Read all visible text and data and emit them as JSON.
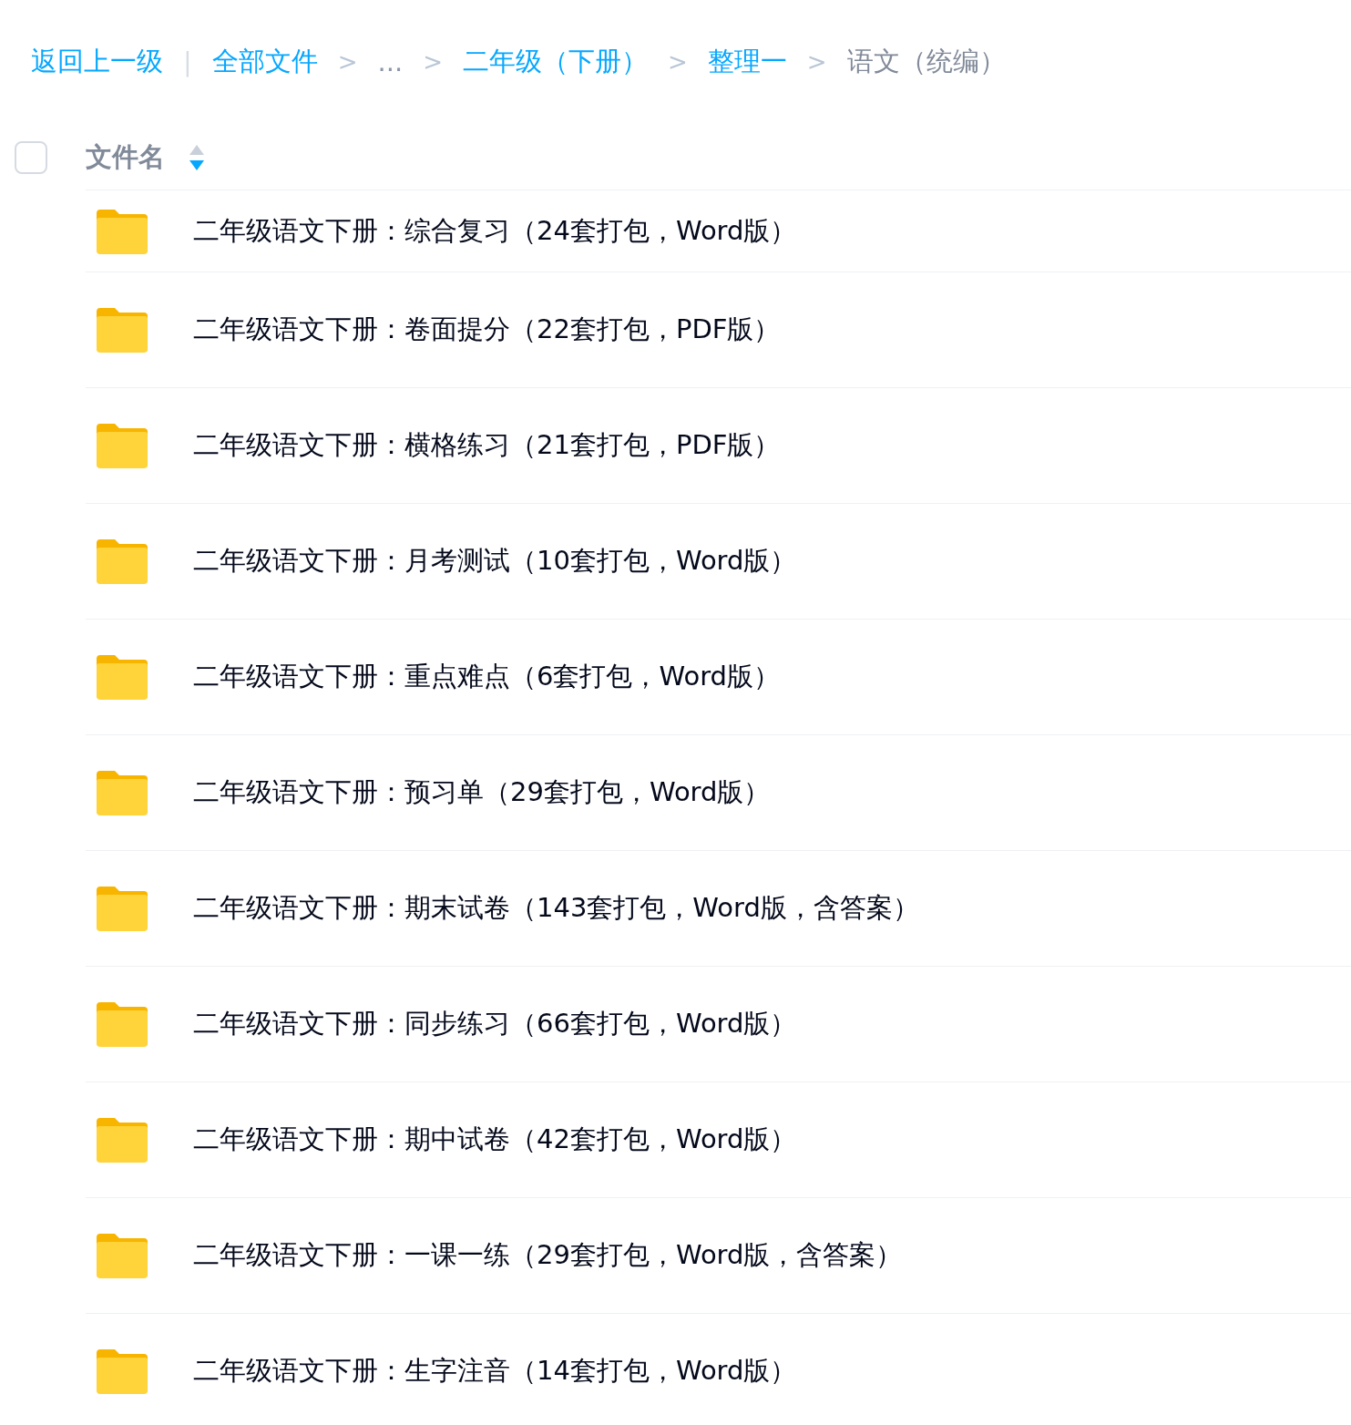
{
  "breadcrumb": [
    {
      "label": "返回上一级",
      "kind": "link"
    },
    {
      "label": "|",
      "kind": "divider"
    },
    {
      "label": "全部文件",
      "kind": "link"
    },
    {
      "label": ">",
      "kind": "separator"
    },
    {
      "label": "...",
      "kind": "ellipsis"
    },
    {
      "label": ">",
      "kind": "separator"
    },
    {
      "label": "二年级（下册）",
      "kind": "link"
    },
    {
      "label": ">",
      "kind": "separator"
    },
    {
      "label": "整理一",
      "kind": "link"
    },
    {
      "label": ">",
      "kind": "separator"
    },
    {
      "label": "语文（统编）",
      "kind": "current"
    }
  ],
  "header": {
    "checked": false,
    "label": "文件名",
    "sort_descending": true
  },
  "files": [
    {
      "name": "二年级语文下册：综合复习（24套打包，Word版）"
    },
    {
      "name": "二年级语文下册：卷面提分（22套打包，PDF版）"
    },
    {
      "name": "二年级语文下册：横格练习（21套打包，PDF版）"
    },
    {
      "name": "二年级语文下册：月考测试（10套打包，Word版）"
    },
    {
      "name": "二年级语文下册：重点难点（6套打包，Word版）"
    },
    {
      "name": "二年级语文下册：预习单（29套打包，Word版）"
    },
    {
      "name": "二年级语文下册：期末试卷（143套打包，Word版，含答案）"
    },
    {
      "name": "二年级语文下册：同步练习（66套打包，Word版）"
    },
    {
      "name": "二年级语文下册：期中试卷（42套打包，Word版）"
    },
    {
      "name": "二年级语文下册：一课一练（29套打包，Word版，含答案）"
    },
    {
      "name": "二年级语文下册：生字注音（14套打包，Word版）"
    }
  ]
}
